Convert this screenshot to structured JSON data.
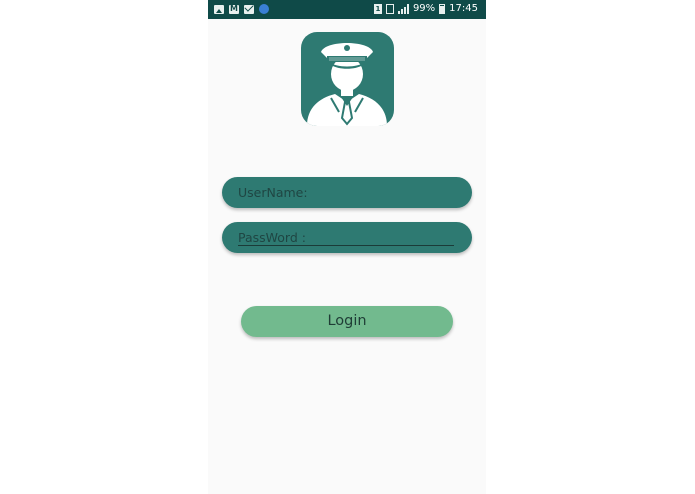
{
  "status_bar": {
    "sim_label": "1",
    "battery_percent": "99%",
    "time": "17:45",
    "left_icons": [
      "gallery-icon",
      "gmail-icon",
      "email-icon",
      "app-notification-icon"
    ],
    "right_icons": [
      "sim-icon",
      "nfc-icon",
      "signal-icon",
      "battery-icon"
    ]
  },
  "logo": {
    "icon": "police-officer-icon",
    "color": "#2e7a72"
  },
  "form": {
    "username_placeholder": "UserName:",
    "username_value": "",
    "password_placeholder": "PassWord :",
    "password_value": ""
  },
  "login_button": {
    "label": "Login",
    "color": "#72ba8e"
  },
  "colors": {
    "status_bar": "#0f4a48",
    "field_background": "#2e7a72",
    "page_background": "#fafafa"
  }
}
